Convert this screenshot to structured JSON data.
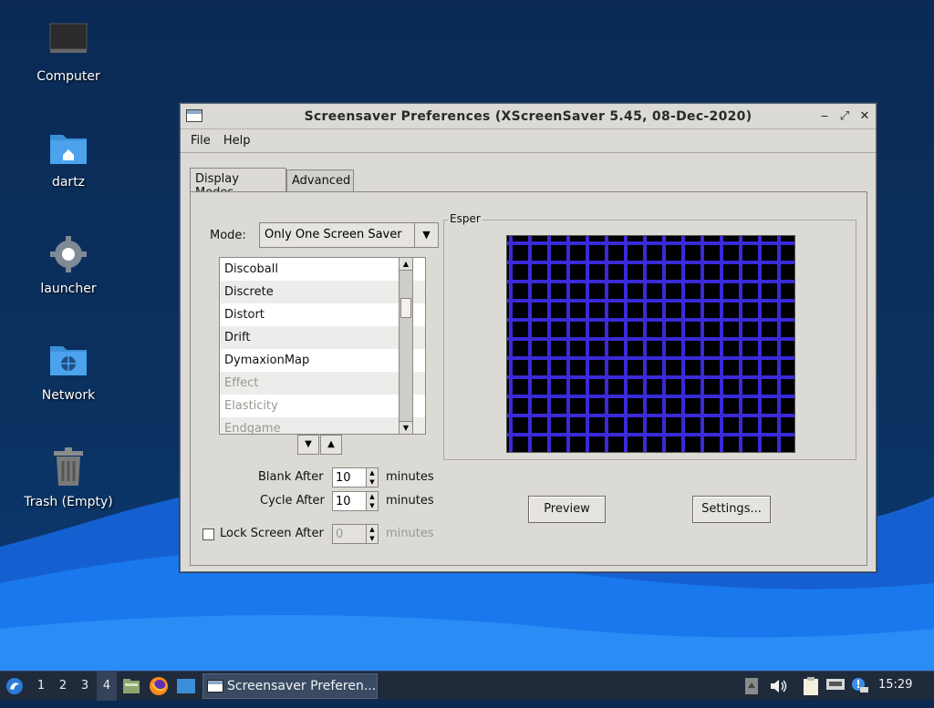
{
  "desktop": {
    "icons": [
      {
        "label": "Computer"
      },
      {
        "label": "dartz"
      },
      {
        "label": "launcher"
      },
      {
        "label": "Network"
      },
      {
        "label": "Trash (Empty)"
      }
    ]
  },
  "window": {
    "title": "Screensaver Preferences  (XScreenSaver 5.45, 08-Dec-2020)",
    "controls": {
      "minimize": "‒",
      "maximize": "⤢",
      "close": "✕"
    },
    "menu": {
      "file": "File",
      "help": "Help"
    },
    "tabs": {
      "display_modes": "Display Modes",
      "advanced": "Advanced"
    },
    "mode": {
      "label": "Mode:",
      "value": "Only One Screen Saver",
      "arrow": "▼"
    },
    "savers": [
      {
        "name": "Discoball",
        "enabled": true
      },
      {
        "name": "Discrete",
        "enabled": true
      },
      {
        "name": "Distort",
        "enabled": true
      },
      {
        "name": "Drift",
        "enabled": true
      },
      {
        "name": "DymaxionMap",
        "enabled": true
      },
      {
        "name": "Effect",
        "enabled": false
      },
      {
        "name": "Elasticity",
        "enabled": false
      },
      {
        "name": "Endgame",
        "enabled": false
      }
    ],
    "list_nav": {
      "down": "▼",
      "up": "▲"
    },
    "blank_after": {
      "label": "Blank After",
      "value": "10",
      "unit": "minutes"
    },
    "cycle_after": {
      "label": "Cycle After",
      "value": "10",
      "unit": "minutes"
    },
    "lock_screen": {
      "label": "Lock Screen After",
      "value": "0",
      "unit": "minutes",
      "checked": false
    },
    "preview_group": {
      "title": "Esper"
    },
    "buttons": {
      "preview": "Preview",
      "settings": "Settings..."
    }
  },
  "taskbar": {
    "workspaces": [
      "1",
      "2",
      "3",
      "4"
    ],
    "active_workspace": "4",
    "task_title": "Screensaver Preferen...",
    "clock": "15:29"
  },
  "colors": {
    "desktop_bg": "#0b2a52",
    "wave": "#1a6fe0",
    "window_bg": "#dcdad5",
    "preview_grid": "#3a2ad8",
    "taskbar": "#1f2a3a"
  }
}
